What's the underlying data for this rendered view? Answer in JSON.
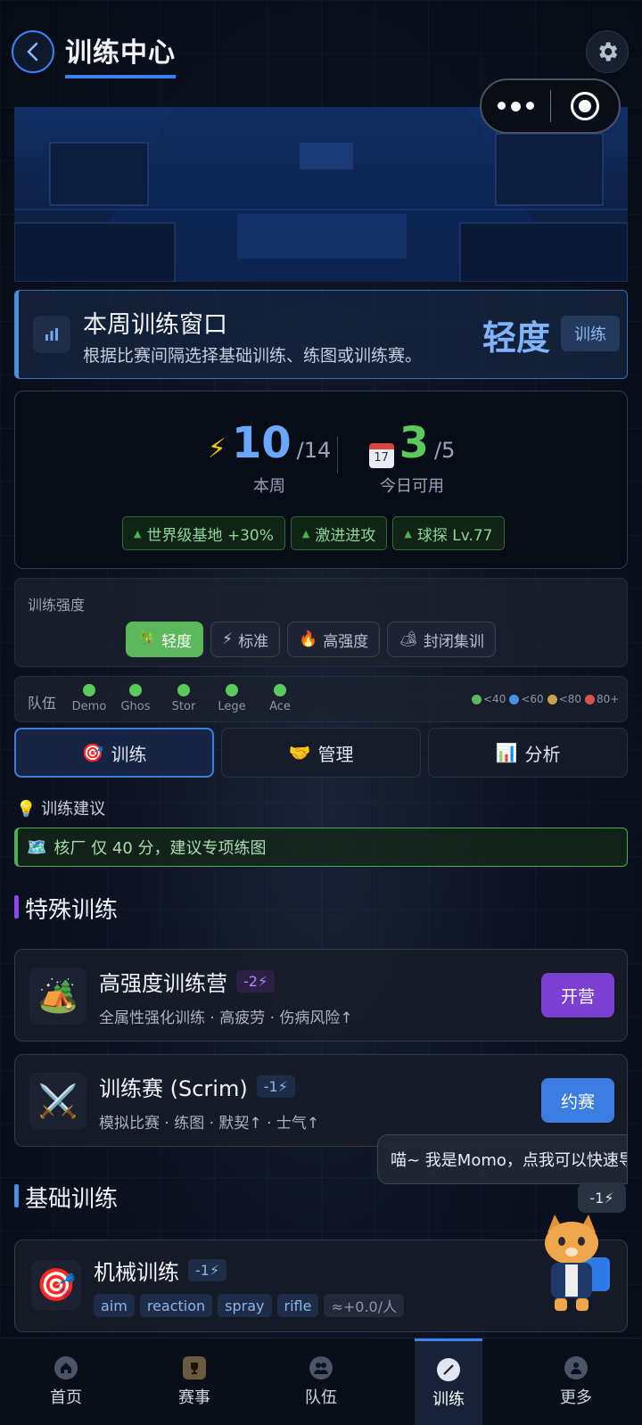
{
  "header": {
    "title": "训练中心",
    "back_icon": "chevron-left-icon",
    "settings_icon": "gear-icon"
  },
  "mini_program_capsule": {
    "more_icon": "more-dots-icon",
    "close_icon": "target-circle-icon"
  },
  "week_window": {
    "title": "本周训练窗口",
    "description": "根据比赛间隔选择基础训练、练图或训练赛。",
    "level": "轻度",
    "tag": "训练"
  },
  "stats": {
    "week": {
      "value": "10",
      "total": "/14",
      "label": "本周",
      "icon": "lightning-icon"
    },
    "today": {
      "value": "3",
      "total": "/5",
      "label": "今日可用",
      "icon": "calendar-icon"
    },
    "bonuses": [
      {
        "label": "世界级基地 +30%"
      },
      {
        "label": "激进进攻"
      },
      {
        "label": "球探 Lv.77"
      }
    ]
  },
  "intensity": {
    "label": "训练强度",
    "options": [
      {
        "icon": "🎋",
        "label": "轻度",
        "active": true
      },
      {
        "icon": "⚡",
        "label": "标准",
        "active": false
      },
      {
        "icon": "🔥",
        "label": "高强度",
        "active": false
      },
      {
        "icon": "🏕",
        "label": "封闭集训",
        "active": false
      }
    ]
  },
  "team": {
    "label": "队伍",
    "members": [
      "Demo",
      "Ghos",
      "Stor",
      "Lege",
      "Ace"
    ],
    "legend": [
      {
        "label": "<40",
        "color": "#5cb85c"
      },
      {
        "label": "<60",
        "color": "#4a90e2"
      },
      {
        "label": "<80",
        "color": "#c9a24a"
      },
      {
        "label": "80+",
        "color": "#d9534f"
      }
    ]
  },
  "tabs": [
    {
      "icon": "🎯",
      "label": "训练",
      "active": true
    },
    {
      "icon": "🤝",
      "label": "管理",
      "active": false
    },
    {
      "icon": "📊",
      "label": "分析",
      "active": false
    }
  ],
  "advice": {
    "title": "训练建议",
    "items": [
      {
        "icon": "🗺️",
        "text": "核厂 仅 40 分，建议专项练图"
      }
    ]
  },
  "special_training": {
    "title": "特殊训练",
    "items": [
      {
        "icon": "🏕️",
        "name": "高强度训练营",
        "cost": "-2⚡",
        "desc": "全属性强化训练 · 高疲劳 · 伤病风险↑",
        "button": "开营",
        "button_color": "#7b3fd1",
        "cost_color": "#b58bf0"
      },
      {
        "icon": "⚔️",
        "name": "训练赛 (Scrim)",
        "cost": "-1⚡",
        "desc": "模拟比赛 · 练图 · 默契↑ · 士气↑",
        "button": "约赛",
        "button_color": "#3b7de0",
        "cost_color": "#8fb4e8"
      }
    ]
  },
  "basic_training": {
    "title": "基础训练",
    "items": [
      {
        "icon": "🎯",
        "name": "机械训练",
        "cost": "-1⚡",
        "tags": [
          "aim",
          "reaction",
          "spray",
          "rifle"
        ],
        "gain": "≈+0.0/人"
      }
    ]
  },
  "assistant": {
    "bubble": "喵~ 我是Momo，点我可以快速导航",
    "cost": "-1⚡",
    "icon": "cat-mascot-icon"
  },
  "bottom_nav": [
    {
      "label": "首页",
      "icon": "home-icon",
      "active": false
    },
    {
      "label": "赛事",
      "icon": "trophy-icon",
      "active": false
    },
    {
      "label": "队伍",
      "icon": "team-icon",
      "active": false
    },
    {
      "label": "训练",
      "icon": "training-icon",
      "active": true
    },
    {
      "label": "更多",
      "icon": "user-icon",
      "active": false
    }
  ],
  "colors": {
    "accent": "#3b82f6",
    "success": "#5cb85c",
    "purple": "#7b3fd1"
  }
}
